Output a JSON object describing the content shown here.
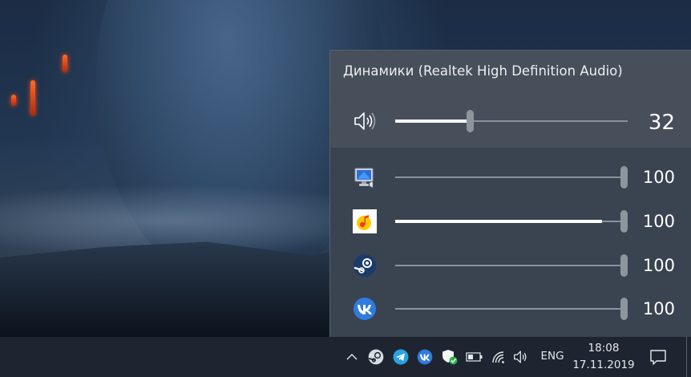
{
  "flyout": {
    "device_name": "Динамики (Realtek High Definition Audio)",
    "master": {
      "icon": "speaker-volume-icon",
      "value": "32",
      "level": 0.32
    },
    "apps": [
      {
        "icon": "system-sounds-icon",
        "value": "100",
        "level": 1.0
      },
      {
        "icon": "yandex-music-icon",
        "value": "100",
        "level": 1.0,
        "peak": 0.89
      },
      {
        "icon": "steam-icon",
        "value": "100",
        "level": 1.0
      },
      {
        "icon": "vk-icon",
        "value": "100",
        "level": 1.0
      }
    ]
  },
  "taskbar": {
    "tray_icons": [
      "chevron-up-icon",
      "steam-icon",
      "telegram-icon",
      "vk-icon",
      "shield-check-icon",
      "battery-icon",
      "wifi-icon",
      "speaker-icon"
    ],
    "language": "ENG",
    "time": "18:08",
    "date": "17.11.2019"
  },
  "colors": {
    "flyout_bg": "#3a4350",
    "header_bg": "#474f5b",
    "taskbar_bg": "#1e2530",
    "slider_fill": "#ffffff",
    "slider_track": "#8a939c"
  }
}
